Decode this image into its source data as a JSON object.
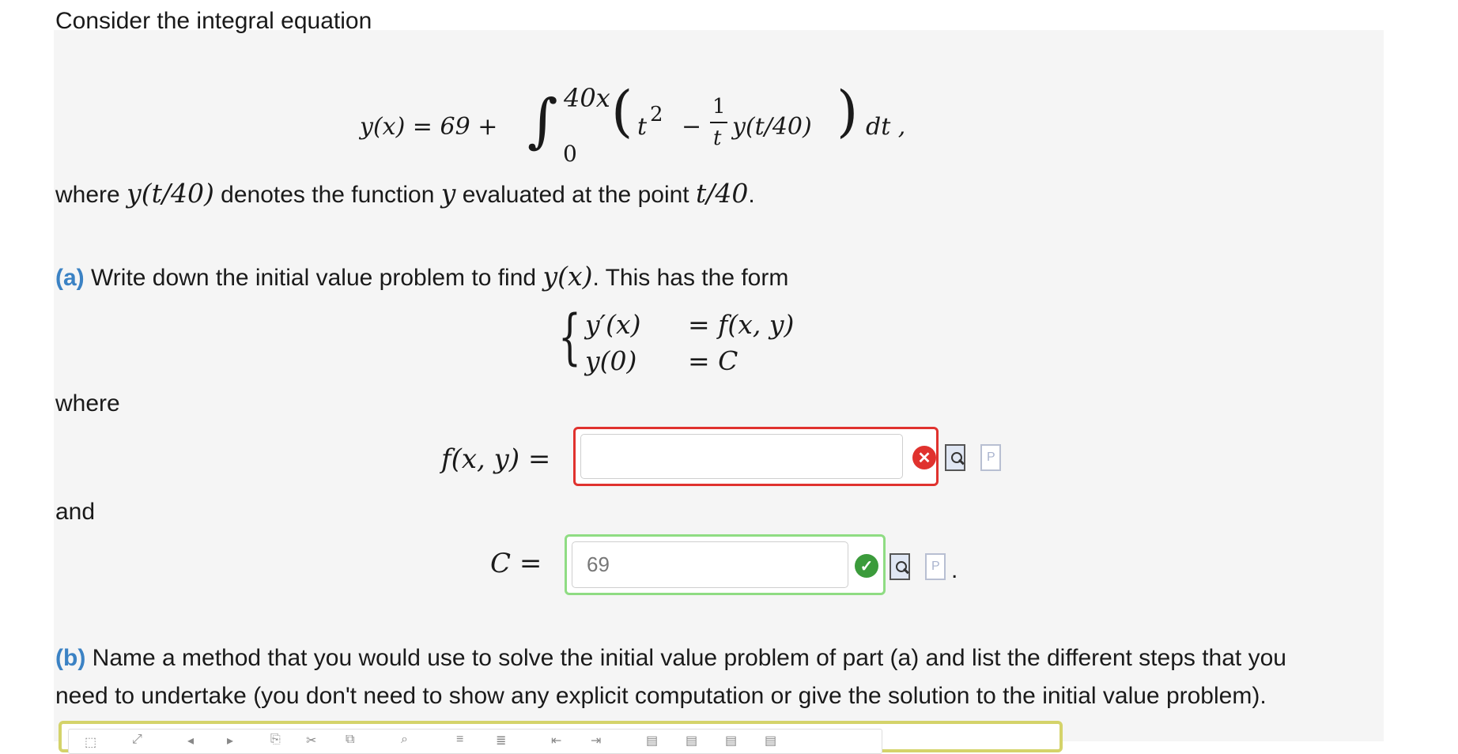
{
  "intro": "Consider the integral equation",
  "equation": {
    "lhs": "y(x) = 69 +",
    "upper": "40x",
    "lower": "0",
    "t2": "t",
    "exp": "2",
    "minus": "−",
    "num": "1",
    "den": "t",
    "func": "y(t/40)",
    "dt": "dt ,"
  },
  "where_text": {
    "pre": "where",
    "func": "y(t/40)",
    "mid": "denotes the function",
    "y": "y",
    "post": "evaluated at the point",
    "point": "t/40",
    "end": "."
  },
  "part_a": {
    "label": "(a)",
    "text": "Write down the initial value problem to find",
    "yx": "y(x)",
    "text2": ". This has the form",
    "system": {
      "l1": "y′(x)",
      "r1": "= f(x, y)",
      "l2": "y(0)",
      "r2": "= C"
    },
    "where_label": "where",
    "and_label": "and",
    "f_label": "f(x, y) =",
    "f_value": "",
    "c_label": "C =",
    "c_value": "69",
    "period": "."
  },
  "part_b": {
    "label": "(b)",
    "line1": "Name a method that you would use to solve the initial value problem of part (a) and list the different steps that you",
    "line2": "need to undertake (you don't need to show any explicit computation or give the solution to the initial value problem)."
  },
  "colors": {
    "error": "#e0322e",
    "correct": "#8fdc83",
    "part_label": "#3b82c4",
    "editor_border": "#d4d36a"
  },
  "icons": [
    "error-icon",
    "preview-icon",
    "p-icon",
    "correct-icon"
  ]
}
